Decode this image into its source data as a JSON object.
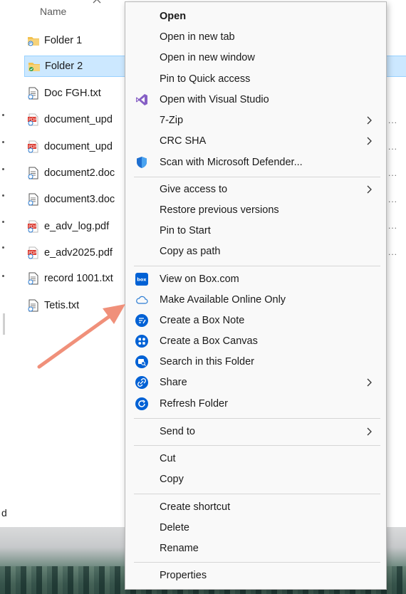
{
  "explorer": {
    "column_header": "Name",
    "files": [
      {
        "name": "Folder 1",
        "type": "folder"
      },
      {
        "name": "Folder 2",
        "type": "folder-sync",
        "selected": true
      },
      {
        "name": "Doc FGH.txt",
        "type": "txt"
      },
      {
        "name": "document_upd",
        "type": "pdf"
      },
      {
        "name": "document_upd",
        "type": "pdf"
      },
      {
        "name": "document2.doc",
        "type": "txt"
      },
      {
        "name": "document3.doc",
        "type": "txt"
      },
      {
        "name": "e_adv_log.pdf",
        "type": "pdf"
      },
      {
        "name": "e_adv2025.pdf",
        "type": "pdf"
      },
      {
        "name": "record 1001.txt",
        "type": "txt"
      },
      {
        "name": "Tetis.txt",
        "type": "txt"
      }
    ],
    "ellipsis": "...",
    "edge_text": "d"
  },
  "context_menu": {
    "items": {
      "open": "Open",
      "open_new_tab": "Open in new tab",
      "open_new_window": "Open in new window",
      "pin_quick_access": "Pin to Quick access",
      "open_visual_studio": "Open with Visual Studio",
      "seven_zip": "7-Zip",
      "crc_sha": "CRC SHA",
      "scan_defender": "Scan with Microsoft Defender...",
      "give_access": "Give access to",
      "restore_versions": "Restore previous versions",
      "pin_start": "Pin to Start",
      "copy_path": "Copy as path",
      "view_box": "View on Box.com",
      "make_online_only": "Make Available Online Only",
      "create_box_note": "Create a Box Note",
      "create_box_canvas": "Create a Box Canvas",
      "search_folder": "Search in this Folder",
      "share": "Share",
      "refresh_folder": "Refresh Folder",
      "send_to": "Send to",
      "cut": "Cut",
      "copy": "Copy",
      "create_shortcut": "Create shortcut",
      "delete": "Delete",
      "rename": "Rename",
      "properties": "Properties"
    },
    "box_icon_text": "box"
  },
  "colors": {
    "selection": "#cce8ff",
    "box_blue": "#0061d5",
    "vs_purple": "#865fc5",
    "defender_blue": "#1f6fd0",
    "arrow_salmon": "#f0907a",
    "folder_yellow": "#f2c14e",
    "pdf_red": "#d93025"
  }
}
